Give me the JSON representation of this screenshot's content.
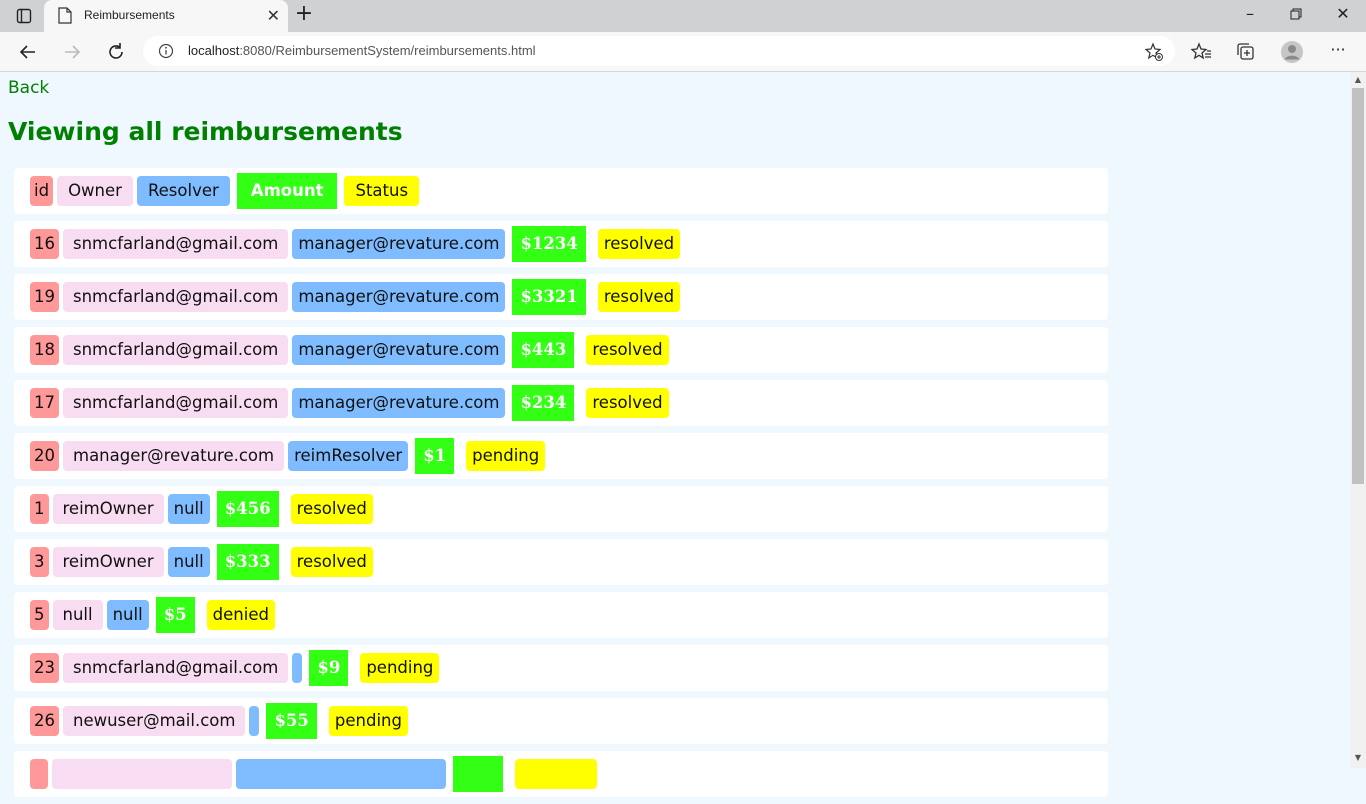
{
  "browser": {
    "tab_title": "Reimbursements",
    "url_host": "localhost",
    "url_rest": ":8080/ReimbursementSystem/reimbursements.html"
  },
  "page": {
    "back_link": "Back",
    "heading": "Viewing all reimbursements"
  },
  "table": {
    "headers": {
      "id": "id",
      "owner": "Owner",
      "resolver": "Resolver",
      "amount": "Amount",
      "status": "Status"
    },
    "rows": [
      {
        "id": "16",
        "owner": "snmcfarland@gmail.com",
        "resolver": "manager@revature.com",
        "amount": "$1234",
        "status": "resolved"
      },
      {
        "id": "19",
        "owner": "snmcfarland@gmail.com",
        "resolver": "manager@revature.com",
        "amount": "$3321",
        "status": "resolved"
      },
      {
        "id": "18",
        "owner": "snmcfarland@gmail.com",
        "resolver": "manager@revature.com",
        "amount": "$443",
        "status": "resolved"
      },
      {
        "id": "17",
        "owner": "snmcfarland@gmail.com",
        "resolver": "manager@revature.com",
        "amount": "$234",
        "status": "resolved"
      },
      {
        "id": "20",
        "owner": "manager@revature.com",
        "resolver": "reimResolver",
        "amount": "$1",
        "status": "pending"
      },
      {
        "id": "1",
        "owner": "reimOwner",
        "resolver": "null",
        "amount": "$456",
        "status": "resolved"
      },
      {
        "id": "3",
        "owner": "reimOwner",
        "resolver": "null",
        "amount": "$333",
        "status": "resolved"
      },
      {
        "id": "5",
        "owner": "null",
        "resolver": "null",
        "amount": "$5",
        "status": "denied"
      },
      {
        "id": "23",
        "owner": "snmcfarland@gmail.com",
        "resolver": "",
        "amount": "$9",
        "status": "pending"
      },
      {
        "id": "26",
        "owner": "newuser@mail.com",
        "resolver": "",
        "amount": "$55",
        "status": "pending"
      }
    ]
  },
  "colors": {
    "page_background": "#f0f8ff",
    "heading": "#008000",
    "id_cell": "#ff9999",
    "owner_cell": "#f8dcf2",
    "resolver_cell": "#7fbcff",
    "amount_cell": "#33ff14",
    "status_cell": "#ffff00"
  },
  "icons": {
    "tab": "page-icon",
    "nav": [
      "back-arrow-icon",
      "forward-arrow-icon",
      "refresh-icon"
    ],
    "url": "info-icon",
    "toolbar": [
      "add-favorite-icon",
      "favorites-icon",
      "collections-icon",
      "profile-icon",
      "more-icon"
    ]
  }
}
